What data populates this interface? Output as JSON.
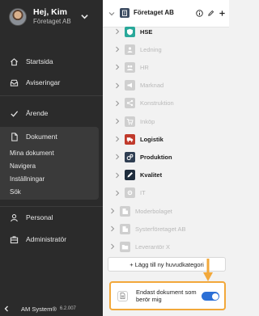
{
  "profile": {
    "name": "Hej, Kim",
    "company": "Företaget AB"
  },
  "nav": {
    "startsida": "Startsida",
    "aviseringar": "Aviseringar",
    "arende": "Ärende",
    "dokument": "Dokument",
    "sub": [
      "Mina dokument",
      "Navigera",
      "Inställningar",
      "Sök"
    ],
    "personal": "Personal",
    "administrator": "Administratör"
  },
  "footer": {
    "product": "AM System®",
    "version": "6.2.007"
  },
  "tree": {
    "root": "Företaget AB",
    "items": [
      {
        "label": "HSE",
        "active": true,
        "color": "#29a89a",
        "icon": "shield-icon"
      },
      {
        "label": "Ledning",
        "active": false,
        "color": "#cfcfcf",
        "icon": "person-icon"
      },
      {
        "label": "HR",
        "active": false,
        "color": "#cfcfcf",
        "icon": "people-icon"
      },
      {
        "label": "Marknad",
        "active": false,
        "color": "#cfcfcf",
        "icon": "megaphone-icon"
      },
      {
        "label": "Konstruktion",
        "active": false,
        "color": "#cfcfcf",
        "icon": "share-icon"
      },
      {
        "label": "Inköp",
        "active": false,
        "color": "#cfcfcf",
        "icon": "cart-icon"
      },
      {
        "label": "Logistik",
        "active": true,
        "color": "#c0392b",
        "icon": "truck-icon"
      },
      {
        "label": "Produktion",
        "active": true,
        "color": "#2f3e52",
        "icon": "gears-icon"
      },
      {
        "label": "Kvalitet",
        "active": true,
        "color": "#1f2d3d",
        "icon": "pencil-icon"
      },
      {
        "label": "IT",
        "active": false,
        "color": "#cfcfcf",
        "icon": "gear-icon"
      },
      {
        "label": "Moderbolaget",
        "active": false,
        "color": "#cfcfcf",
        "icon": "building-icon"
      },
      {
        "label": "Systerföretaget AB",
        "active": false,
        "color": "#cfcfcf",
        "icon": "building-icon"
      },
      {
        "label": "Leverantör X",
        "active": false,
        "color": "#cfcfcf",
        "icon": "folder-icon"
      }
    ],
    "add_label": "+ Lägg till ny huvudkategori",
    "filter_label": "Endast dokument som berör mig",
    "filter_on": true
  },
  "colors": {
    "sidebar": "#2b2b2b",
    "accent": "#2b6fd6",
    "highlight": "#f2a83a"
  }
}
